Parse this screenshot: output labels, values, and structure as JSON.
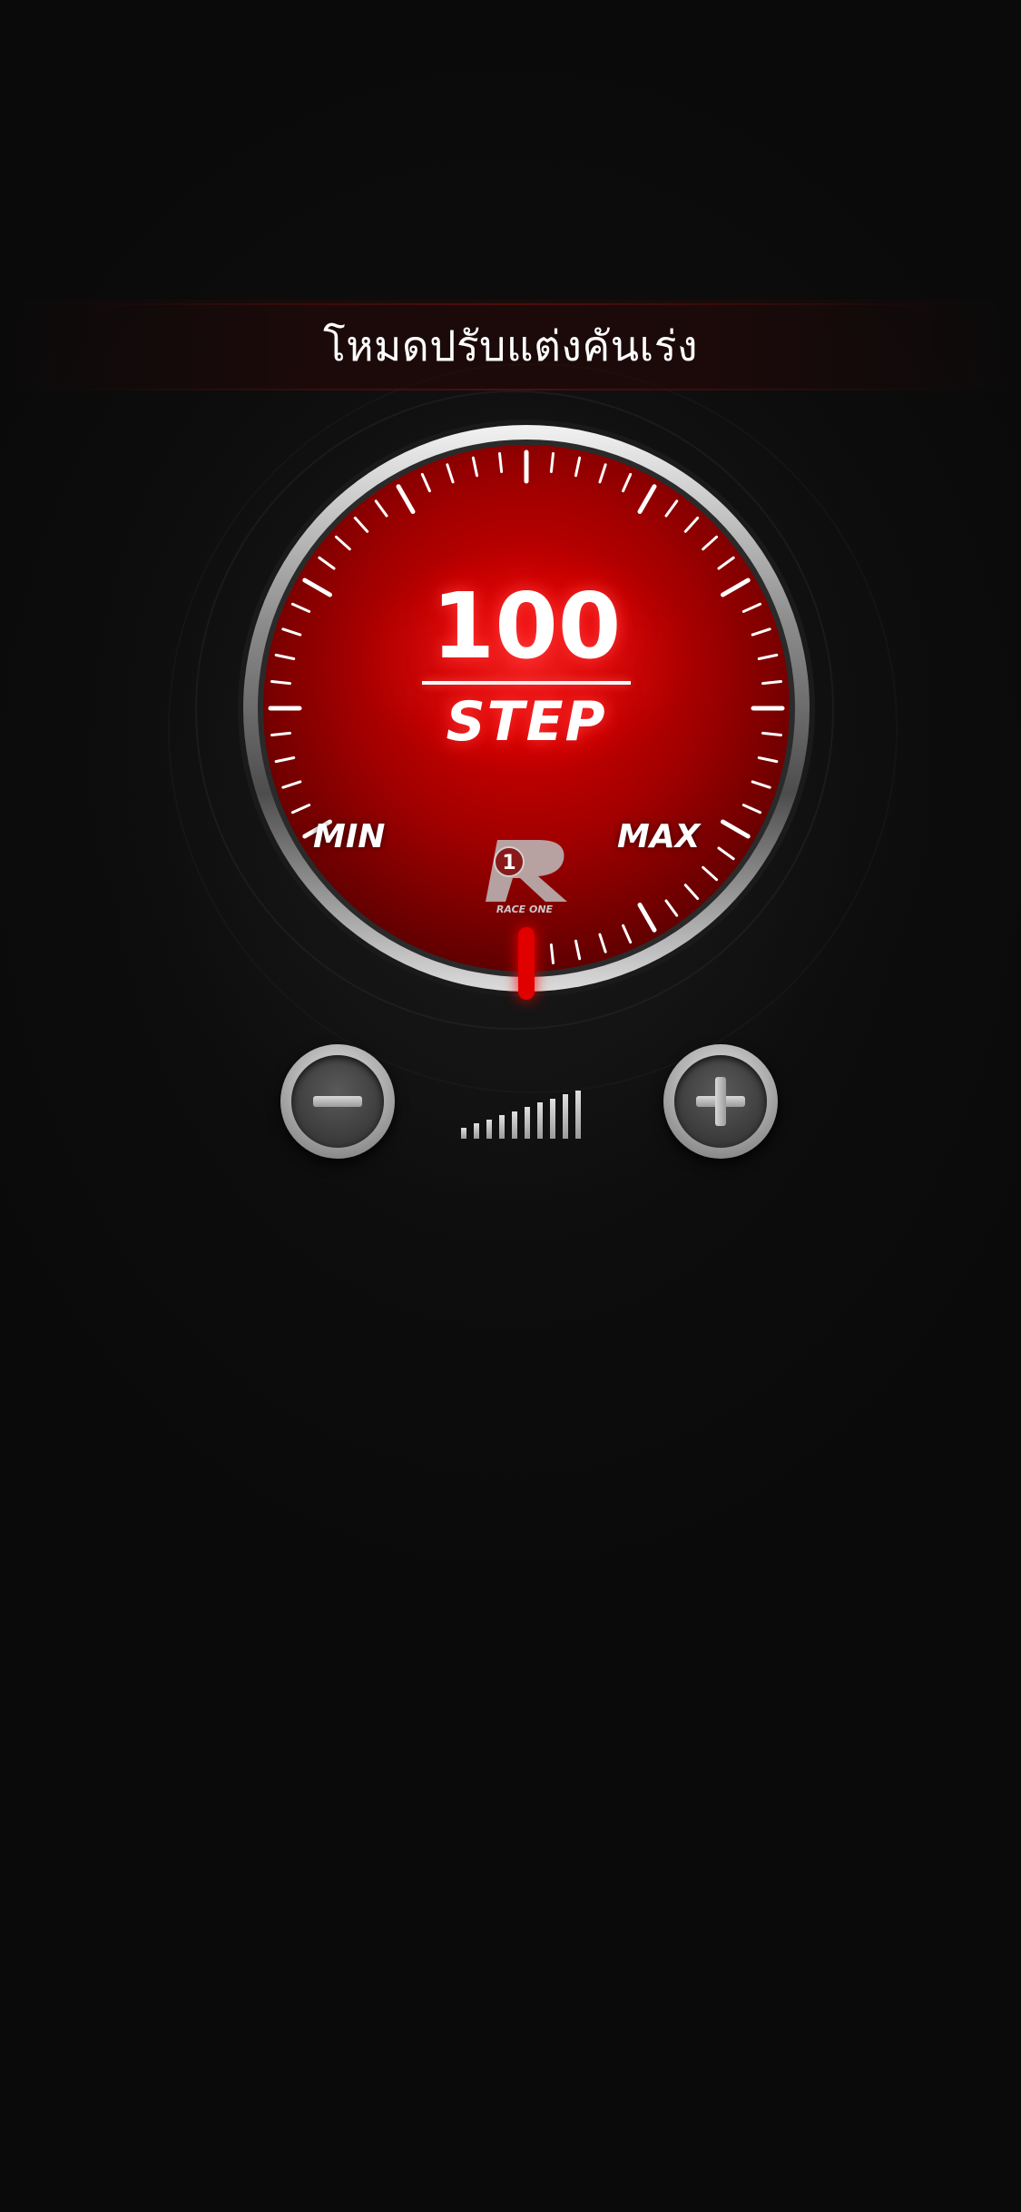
{
  "header": {
    "title": "โหมดปรับแต่งคันเร่ง"
  },
  "gauge": {
    "value": "100",
    "unit": "STEP",
    "min_label": "MIN",
    "max_label": "MAX",
    "level_fraction": 1.0,
    "accent_color": "#e00000",
    "face_color": "#b00000"
  },
  "brand": {
    "logo_text": "RACE ONE",
    "logo_numeral": "1",
    "logo_letter": "R"
  },
  "controls": {
    "decrease_icon": "minus-icon",
    "increase_icon": "plus-icon",
    "level_indicator_icon": "signal-level-icon",
    "level_bars_count": 10
  }
}
